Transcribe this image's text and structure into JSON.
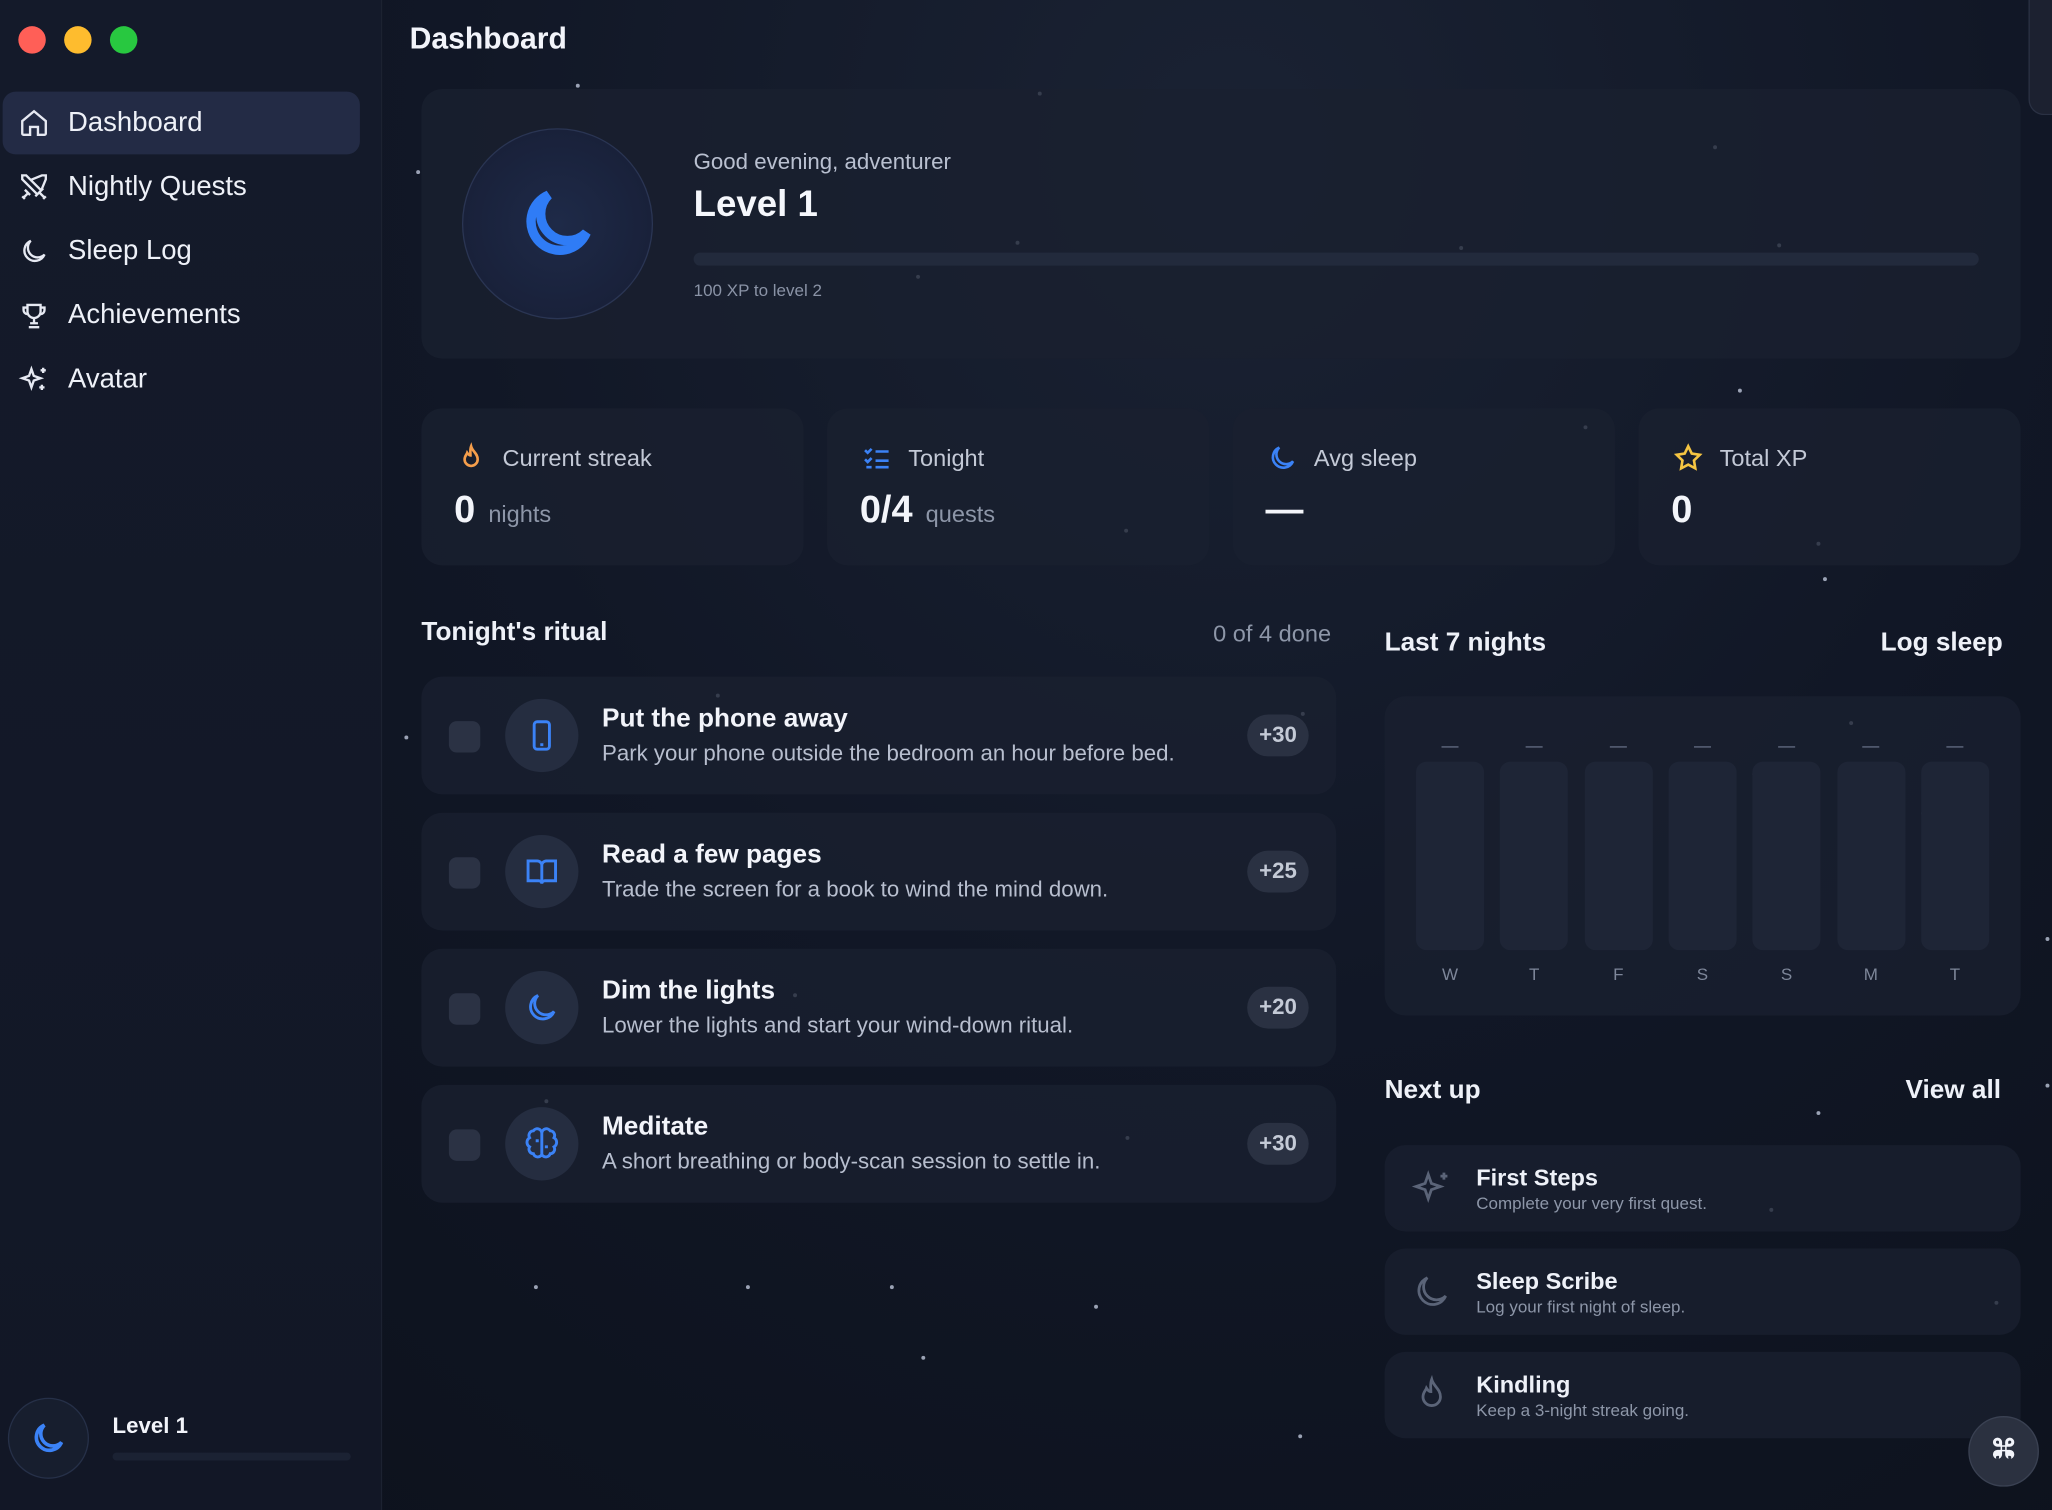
{
  "window": {
    "title": "Dashboard"
  },
  "sidebar": {
    "items": [
      {
        "label": "Dashboard",
        "icon": "home-icon",
        "active": true
      },
      {
        "label": "Nightly Quests",
        "icon": "swords-icon"
      },
      {
        "label": "Sleep Log",
        "icon": "moon-icon"
      },
      {
        "label": "Achievements",
        "icon": "trophy-icon"
      },
      {
        "label": "Avatar",
        "icon": "sparkles-icon"
      }
    ],
    "footer": {
      "level": "Level 1"
    }
  },
  "hero": {
    "greeting": "Good evening, adventurer",
    "level": "Level 1",
    "xp_text": "100 XP to level 2",
    "xp_progress": 0
  },
  "stats": [
    {
      "label": "Current streak",
      "value": "0",
      "unit": "nights",
      "icon": "flame-icon",
      "color": "#f59e4b"
    },
    {
      "label": "Tonight",
      "value": "0/4",
      "unit": "quests",
      "icon": "list-check-icon",
      "color": "#3b82f6"
    },
    {
      "label": "Avg sleep",
      "value": "—",
      "unit": "",
      "icon": "moon-icon",
      "color": "#3b82f6"
    },
    {
      "label": "Total XP",
      "value": "0",
      "unit": "",
      "icon": "star-icon",
      "color": "#f5c542"
    }
  ],
  "ritual": {
    "title": "Tonight's ritual",
    "meta": "0 of 4 done",
    "quests": [
      {
        "title": "Put the phone away",
        "desc": "Park your phone outside the bedroom an hour before bed.",
        "xp": "+30",
        "icon": "phone-icon"
      },
      {
        "title": "Read a few pages",
        "desc": "Trade the screen for a book to wind the mind down.",
        "xp": "+25",
        "icon": "book-icon"
      },
      {
        "title": "Dim the lights",
        "desc": "Lower the lights and start your wind-down ritual.",
        "xp": "+20",
        "icon": "moon-icon"
      },
      {
        "title": "Meditate",
        "desc": "A short breathing or body-scan session to settle in.",
        "xp": "+30",
        "icon": "brain-icon"
      }
    ]
  },
  "last_nights": {
    "title": "Last 7 nights",
    "action": "Log sleep",
    "days": [
      "W",
      "T",
      "F",
      "S",
      "S",
      "M",
      "T"
    ],
    "hours": [
      null,
      null,
      null,
      null,
      null,
      null,
      null
    ],
    "value_labels": [
      "—",
      "—",
      "—",
      "—",
      "—",
      "—",
      "—"
    ]
  },
  "next_up": {
    "title": "Next up",
    "action": "View all",
    "items": [
      {
        "title": "First Steps",
        "desc": "Complete your very first quest.",
        "icon": "sparkle-icon"
      },
      {
        "title": "Sleep Scribe",
        "desc": "Log your first night of sleep.",
        "icon": "moon-icon"
      },
      {
        "title": "Kindling",
        "desc": "Keep a 3-night streak going.",
        "icon": "flame-icon"
      }
    ]
  },
  "colors": {
    "accent": "#3b82f6",
    "background": "#111726",
    "card": "#1a2030"
  }
}
